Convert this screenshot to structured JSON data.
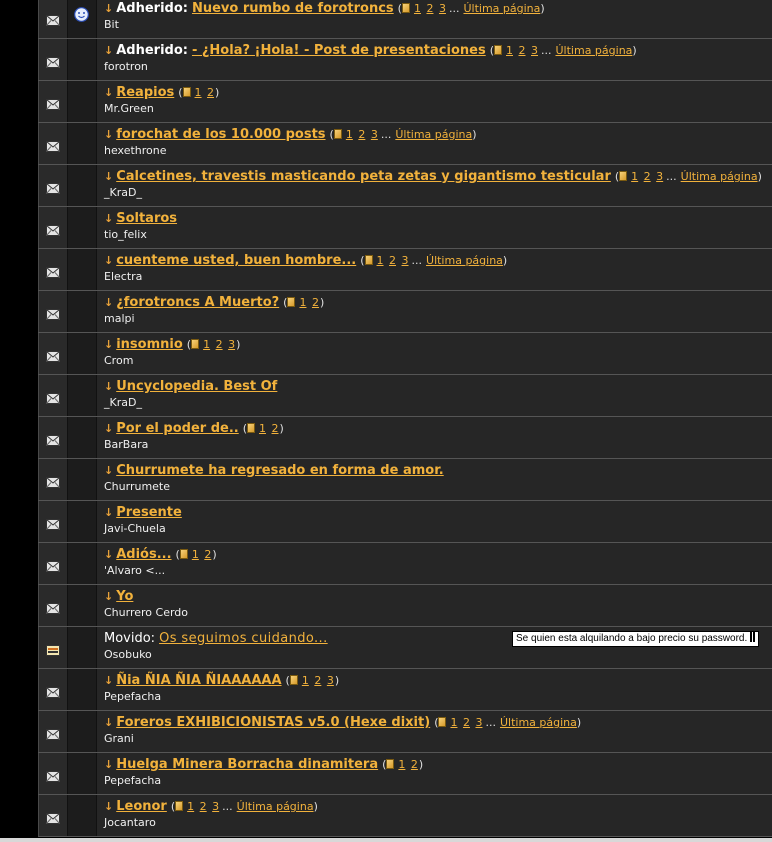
{
  "labels": {
    "sticky_prefix": "Adherido:",
    "moved_prefix": "Movido:",
    "last_page": "Última página",
    "ellipsis": "..."
  },
  "colors": {
    "title": "#f2b23c",
    "row_bg": "#262626",
    "text": "#f0f0f0"
  },
  "tooltip": {
    "text": "Se quien esta alquilando a bajo precio su password."
  },
  "topics": [
    {
      "type": "sticky",
      "title": "Nuevo rumbo de forotroncs",
      "author": "Bit",
      "pages": [
        "1",
        "2",
        "3"
      ],
      "last": true,
      "smiley": true
    },
    {
      "type": "sticky",
      "title": "- ¿Hola? ¡Hola! - Post de presentaciones",
      "author": "forotron",
      "pages": [
        "1",
        "2",
        "3"
      ],
      "last": true
    },
    {
      "type": "normal",
      "title": "Reapios",
      "author": "Mr.Green",
      "pages": [
        "1",
        "2"
      ],
      "last": false
    },
    {
      "type": "normal",
      "title": "forochat de los 10.000 posts",
      "author": "hexethrone",
      "pages": [
        "1",
        "2",
        "3"
      ],
      "last": true
    },
    {
      "type": "normal",
      "title": "Calcetines, travestis masticando peta zetas y gigantismo testicular",
      "author": "_KraD_",
      "pages": [
        "1",
        "2",
        "3"
      ],
      "last": true
    },
    {
      "type": "normal",
      "title": "Soltaros",
      "author": "tio_felix",
      "pages": [],
      "last": false
    },
    {
      "type": "normal",
      "title": "cuenteme usted, buen hombre...",
      "author": "Electra",
      "pages": [
        "1",
        "2",
        "3"
      ],
      "last": true
    },
    {
      "type": "normal",
      "title": "¿forotroncs A Muerto?",
      "author": "malpi",
      "pages": [
        "1",
        "2"
      ],
      "last": false
    },
    {
      "type": "normal",
      "title": "insomnio",
      "author": "Crom",
      "pages": [
        "1",
        "2",
        "3"
      ],
      "last": false
    },
    {
      "type": "normal",
      "title": "Uncyclopedia. Best Of",
      "author": "_KraD_",
      "pages": [],
      "last": false
    },
    {
      "type": "normal",
      "title": "Por el poder de..",
      "author": "BarBara",
      "pages": [
        "1",
        "2"
      ],
      "last": false
    },
    {
      "type": "normal",
      "title": "Churrumete ha regresado en forma de amor.",
      "author": "Churrumete",
      "pages": [],
      "last": false
    },
    {
      "type": "normal",
      "title": "Presente",
      "author": "Javi-Chuela",
      "pages": [],
      "last": false
    },
    {
      "type": "normal",
      "title": "Adiós...",
      "author": "'Alvaro <...",
      "pages": [
        "1",
        "2"
      ],
      "last": false
    },
    {
      "type": "normal",
      "title": "Yo",
      "author": "Churrero Cerdo",
      "pages": [],
      "last": false
    },
    {
      "type": "moved",
      "title": "Os seguimos cuidando...",
      "author": "Osobuko",
      "pages": [],
      "last": false
    },
    {
      "type": "normal",
      "title": "Ñia ÑIA ÑIA ÑIAAAAAA",
      "author": "Pepefacha",
      "pages": [
        "1",
        "2",
        "3"
      ],
      "last": false
    },
    {
      "type": "normal",
      "title": "Foreros EXHIBICIONISTAS v5.0 (Hexe dixit)",
      "author": "Grani",
      "pages": [
        "1",
        "2",
        "3"
      ],
      "last": true
    },
    {
      "type": "normal",
      "title": "Huelga Minera Borracha dinamitera",
      "author": "Pepefacha",
      "pages": [
        "1",
        "2"
      ],
      "last": false
    },
    {
      "type": "normal",
      "title": "Leonor",
      "author": "Jocantaro",
      "pages": [
        "1",
        "2",
        "3"
      ],
      "last": true
    }
  ]
}
